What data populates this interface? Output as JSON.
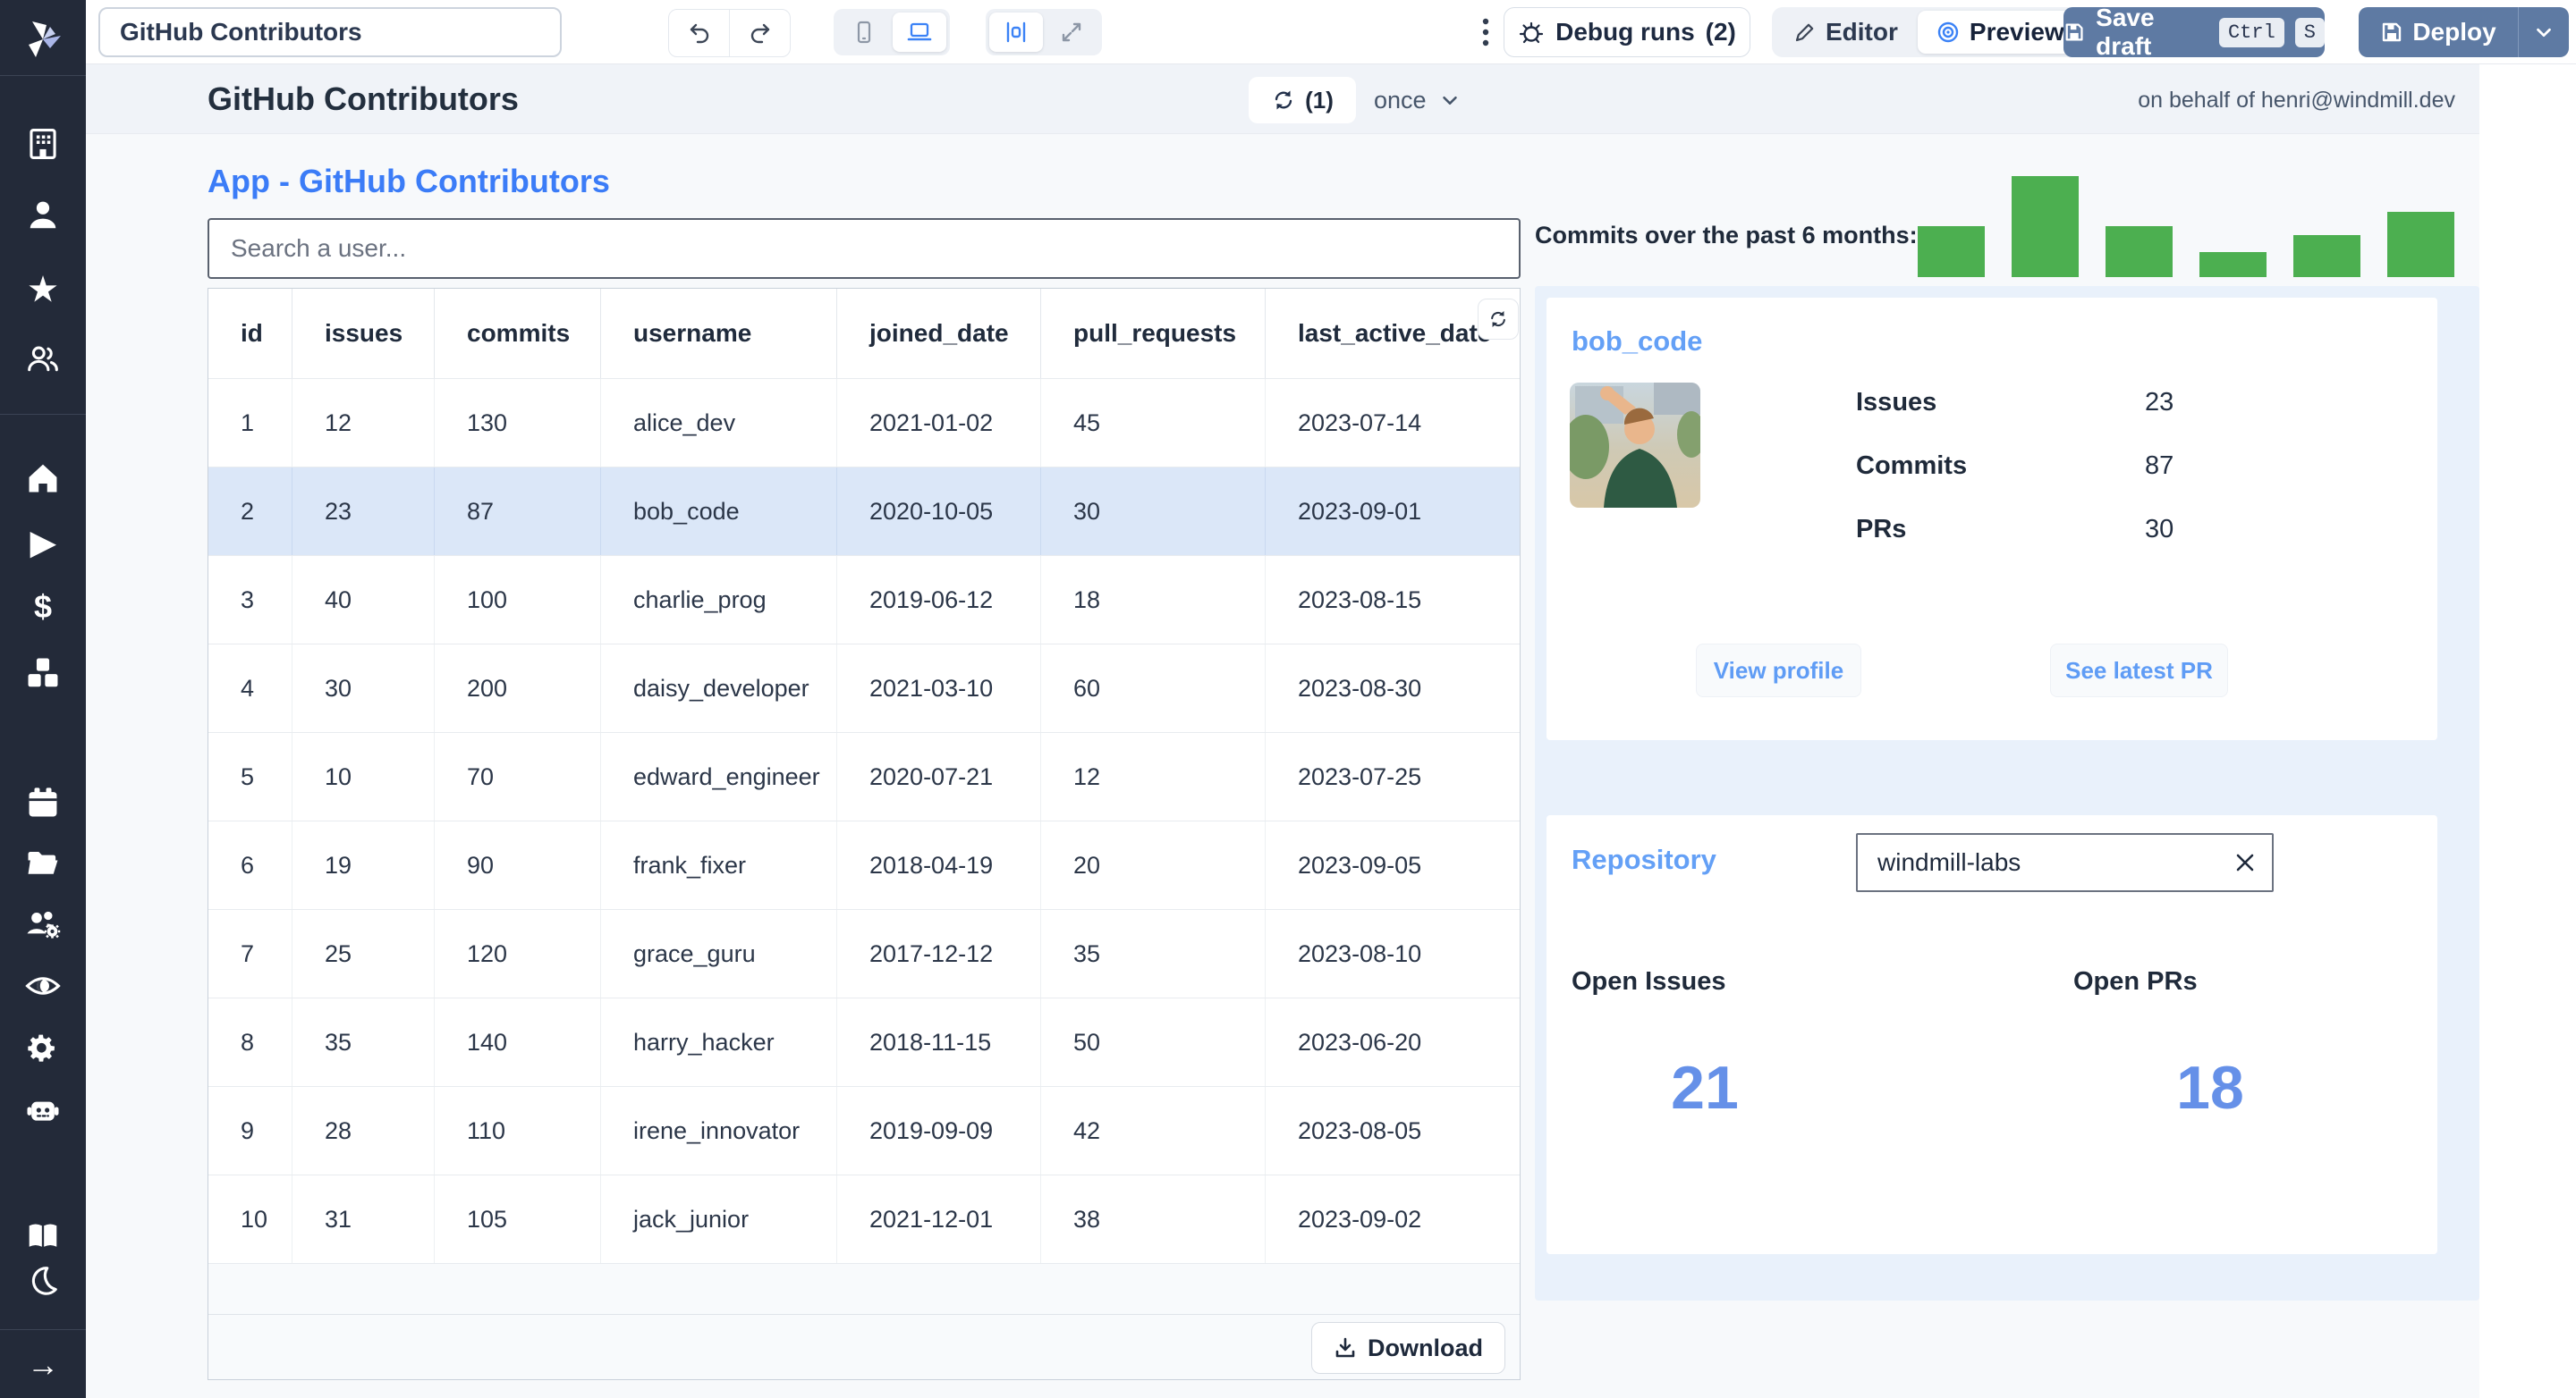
{
  "topbar": {
    "app_name": "GitHub Contributors",
    "debug_runs_label": "Debug runs",
    "debug_runs_count": "(2)",
    "editor_label": "Editor",
    "preview_label": "Preview",
    "save_draft_label": "Save draft",
    "kbd_ctrl": "Ctrl",
    "kbd_s": "S",
    "deploy_label": "Deploy"
  },
  "header": {
    "title": "GitHub Contributors",
    "refresh_count": "(1)",
    "schedule": "once",
    "on_behalf_of": "on behalf of henri@windmill.dev"
  },
  "app": {
    "subtitle": "App - GitHub Contributors",
    "search_placeholder": "Search a user..."
  },
  "table": {
    "columns": [
      "id",
      "issues",
      "commits",
      "username",
      "joined_date",
      "pull_requests",
      "last_active_date"
    ],
    "rows": [
      [
        "1",
        "12",
        "130",
        "alice_dev",
        "2021-01-02",
        "45",
        "2023-07-14"
      ],
      [
        "2",
        "23",
        "87",
        "bob_code",
        "2020-10-05",
        "30",
        "2023-09-01"
      ],
      [
        "3",
        "40",
        "100",
        "charlie_prog",
        "2019-06-12",
        "18",
        "2023-08-15"
      ],
      [
        "4",
        "30",
        "200",
        "daisy_developer",
        "2021-03-10",
        "60",
        "2023-08-30"
      ],
      [
        "5",
        "10",
        "70",
        "edward_engineer",
        "2020-07-21",
        "12",
        "2023-07-25"
      ],
      [
        "6",
        "19",
        "90",
        "frank_fixer",
        "2018-04-19",
        "20",
        "2023-09-05"
      ],
      [
        "7",
        "25",
        "120",
        "grace_guru",
        "2017-12-12",
        "35",
        "2023-08-10"
      ],
      [
        "8",
        "35",
        "140",
        "harry_hacker",
        "2018-11-15",
        "50",
        "2023-06-20"
      ],
      [
        "9",
        "28",
        "110",
        "irene_innovator",
        "2019-09-09",
        "42",
        "2023-08-05"
      ],
      [
        "10",
        "31",
        "105",
        "jack_junior",
        "2021-12-01",
        "38",
        "2023-09-02"
      ]
    ],
    "selected_row_index": 1,
    "download_label": "Download"
  },
  "chart_data": {
    "type": "bar",
    "title": "Commits over the past 6 months:",
    "values": [
      50,
      100,
      50,
      25,
      42,
      65
    ],
    "ylim": [
      0,
      100
    ],
    "bar_color": "#4caf50",
    "grid": false,
    "axes_shown": false
  },
  "profile_card": {
    "title": "bob_code",
    "stats": [
      {
        "label": "Issues",
        "value": "23"
      },
      {
        "label": "Commits",
        "value": "87"
      },
      {
        "label": "PRs",
        "value": "30"
      }
    ],
    "view_profile_label": "View profile",
    "see_latest_pr_label": "See latest PR"
  },
  "repository_card": {
    "title": "Repository",
    "input_value": "windmill-labs",
    "open_issues_label": "Open Issues",
    "open_issues_value": "21",
    "open_prs_label": "Open PRs",
    "open_prs_value": "18"
  },
  "sidebar": {
    "icons": [
      "windmill-logo",
      "workspace",
      "user",
      "favorites",
      "groups",
      "home",
      "runs",
      "variables",
      "resources",
      "schedules",
      "folders",
      "workers",
      "audit-logs",
      "settings",
      "ai",
      "docs",
      "dark-mode",
      "expand"
    ]
  },
  "colors": {
    "sidebar_bg": "#232a39",
    "accent_blue": "#3b82f6",
    "link_blue": "#64a0f6",
    "big_number_blue": "#6590e8",
    "action_button_blue": "#5e7aa3",
    "bar_green": "#4caf50",
    "selected_row": "#dbe7f8",
    "panel_blue": "#e9f1fb",
    "header_band": "#f0f3f8"
  }
}
